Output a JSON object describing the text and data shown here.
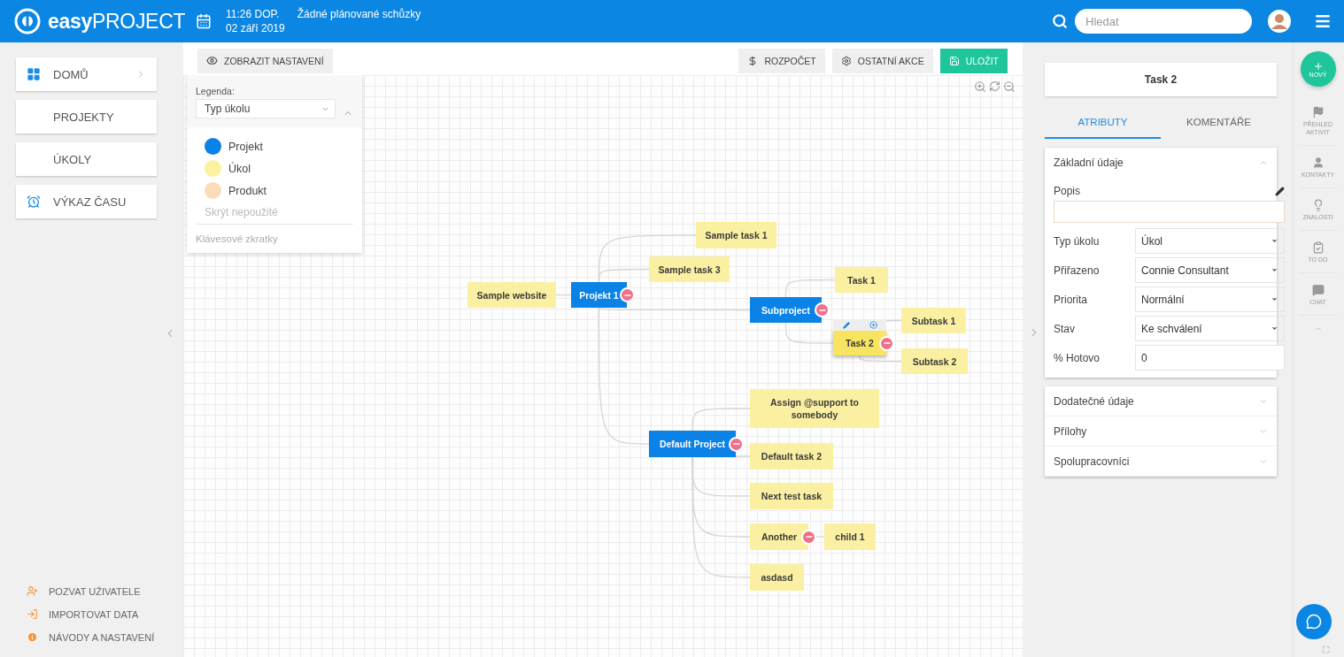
{
  "header": {
    "logo": "**easy**PROJECT",
    "time": "11:26 DOP.",
    "date": "02 září 2019",
    "meetings": "Žádné plánované schůzky",
    "search": {
      "placeholder": "Hledat"
    }
  },
  "sidebar": {
    "items": [
      {
        "label": "DOMŮ",
        "kind": "dashboard"
      },
      {
        "label": "PROJEKTY",
        "kind": "plain"
      },
      {
        "label": "ÚKOLY",
        "kind": "plain"
      },
      {
        "label": "VÝKAZ ČASU",
        "kind": "timesheet"
      }
    ],
    "links": [
      {
        "label": "POZVAT UŽIVATELE",
        "kind": "invite"
      },
      {
        "label": "IMPORTOVAT DATA",
        "kind": "import"
      },
      {
        "label": "NÁVODY A NASTAVENÍ",
        "kind": "help"
      }
    ]
  },
  "toolbar": {
    "left": [
      {
        "label": "ZOBRAZIT NASTAVENÍ"
      }
    ],
    "right": [
      {
        "label": "ROZPOČET",
        "kind": "budget"
      },
      {
        "label": "OSTATNÍ AKCE",
        "kind": "actions"
      },
      {
        "label": "ULOŽIT",
        "kind": "save"
      }
    ]
  },
  "legend": {
    "label": "Legenda:",
    "select": "Typ úkolu",
    "expanded": true,
    "items": [
      {
        "label": "Projekt",
        "color": "#0a82e6"
      },
      {
        "label": "Úkol",
        "color": "#fbf2a0"
      },
      {
        "label": "Produkt",
        "color": "#fcdcb8"
      }
    ],
    "hide_unused": "Skrýt nepoužité",
    "shortcuts": "Klávesové zkratky"
  },
  "mind_map": {
    "root": {
      "label": "Projekt 1",
      "kind": "project",
      "selected": false,
      "expanded": true,
      "children": [
        {
          "label": "Sample website",
          "kind": "task",
          "selected": false
        },
        {
          "label": "Sample task 1",
          "kind": "task",
          "selected": false
        },
        {
          "label": "Sample task 3",
          "kind": "task",
          "selected": false
        },
        {
          "label": "Subproject",
          "kind": "project",
          "selected": false,
          "expanded": true,
          "children": [
            {
              "label": "Task  1",
              "kind": "task",
              "selected": false
            },
            {
              "label": "Task 2",
              "kind": "task",
              "selected": true,
              "expanded": true,
              "children": [
                {
                  "label": "Subtask 1",
                  "kind": "task",
                  "selected": false
                },
                {
                  "label": "Subtask  2",
                  "kind": "task",
                  "selected": false
                }
              ]
            }
          ]
        },
        {
          "label": "Default Project",
          "kind": "project",
          "selected": false,
          "expanded": true,
          "children": [
            {
              "label": "Assign @support to somebody",
              "kind": "task",
              "selected": false
            },
            {
              "label": "Default task 2",
              "kind": "task",
              "selected": false
            },
            {
              "label": "Next test task",
              "kind": "task",
              "selected": false
            },
            {
              "label": "Another",
              "kind": "task",
              "selected": false,
              "expanded": true,
              "children": [
                {
                  "label": "child 1",
                  "kind": "task",
                  "selected": false
                }
              ]
            },
            {
              "label": "asdasd",
              "kind": "task",
              "selected": false
            }
          ]
        }
      ]
    }
  },
  "detail": {
    "title": "Task 2",
    "tabs": [
      {
        "label": "ATRIBUTY",
        "selected": true
      },
      {
        "label": "KOMENTÁŘE",
        "selected": false
      }
    ],
    "sections": [
      {
        "title": "Základní údaje",
        "expanded": true
      },
      {
        "title": "Dodatečné údaje",
        "expanded": false
      },
      {
        "title": "Přílohy",
        "expanded": false
      },
      {
        "title": "Spolupracovníci",
        "expanded": false
      }
    ],
    "description_label": "Popis",
    "fields": [
      {
        "label": "Typ úkolu",
        "kind": "select",
        "value": "Úkol"
      },
      {
        "label": "Přiřazeno",
        "kind": "select",
        "value": "Connie Consultant"
      },
      {
        "label": "Priorita",
        "kind": "select",
        "value": "Normální"
      },
      {
        "label": "Stav",
        "kind": "select",
        "value": "Ke schválení"
      },
      {
        "label": "% Hotovo",
        "kind": "input",
        "value": "0"
      }
    ]
  },
  "rail": {
    "new_label": "NOVÝ",
    "items": [
      {
        "label": "PŘEHLED AKTIVIT",
        "kind": "activity"
      },
      {
        "label": "KONTAKTY",
        "kind": "contacts"
      },
      {
        "label": "ZNALOSTI",
        "kind": "knowledge"
      },
      {
        "label": "TO DO",
        "kind": "todo"
      },
      {
        "label": "CHAT",
        "kind": "chat"
      }
    ]
  }
}
